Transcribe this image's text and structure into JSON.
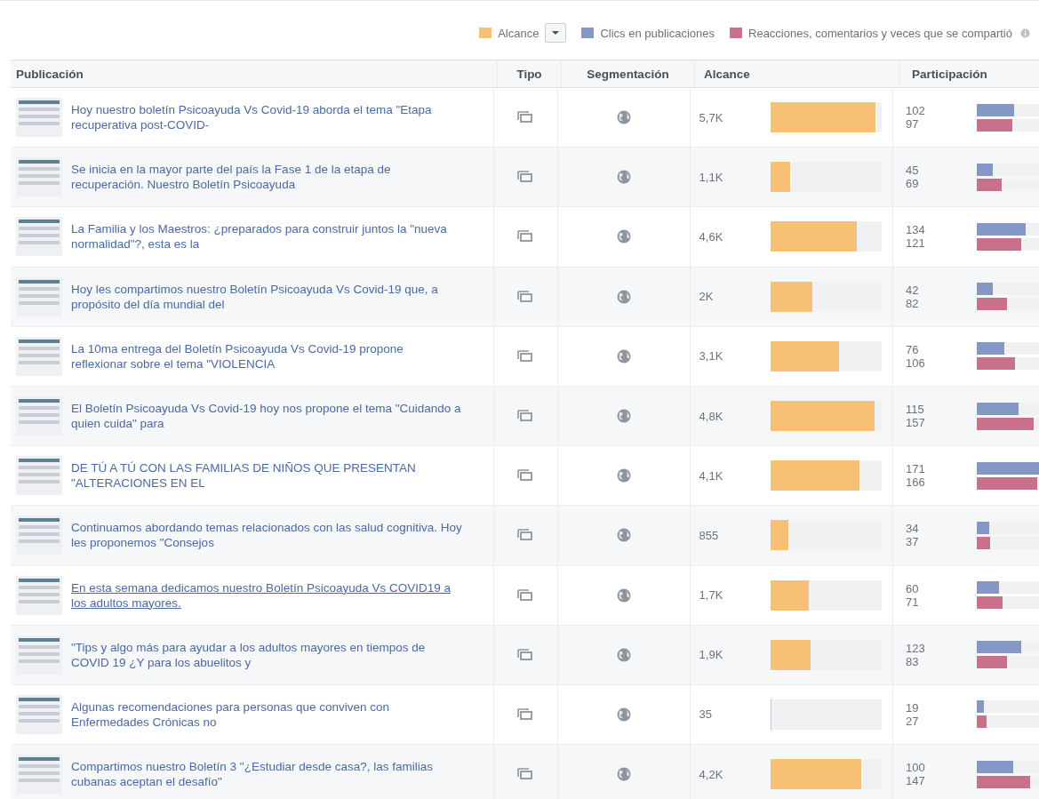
{
  "legend": {
    "items": [
      {
        "label": "Alcance",
        "color": "#f7c074"
      },
      {
        "label": "Clics en publicaciones",
        "color": "#8597c4"
      },
      {
        "label": "Reacciones, comentarios y veces que se compartió",
        "color": "#c9708a"
      }
    ]
  },
  "table": {
    "columns": [
      "Publicación",
      "Tipo",
      "Segmentación",
      "Alcance",
      "Participación"
    ],
    "rows": [
      {
        "text": "Hoy nuestro boletín Psicoayuda Vs Covid-19 aborda el tema \"Etapa recuperativa post-COVID-",
        "hovered": false,
        "reach": {
          "value": "5,7K",
          "level": 0.95
        },
        "clicks": {
          "value": "102",
          "level": 0.6
        },
        "reactions": {
          "value": "97",
          "level": 0.57
        }
      },
      {
        "text": "Se inicia en la mayor parte del país la Fase 1 de la etapa de recuperación. Nuestro Boletín Psicoayuda",
        "hovered": false,
        "reach": {
          "value": "1,1K",
          "level": 0.18
        },
        "clicks": {
          "value": "45",
          "level": 0.26
        },
        "reactions": {
          "value": "69",
          "level": 0.4
        }
      },
      {
        "text": "La Familia y los Maestros: ¿preparados para construir juntos la \"nueva normalidad\"?, esta es la",
        "hovered": false,
        "reach": {
          "value": "4,6K",
          "level": 0.78
        },
        "clicks": {
          "value": "134",
          "level": 0.78
        },
        "reactions": {
          "value": "121",
          "level": 0.71
        }
      },
      {
        "text": "Hoy les compartimos nuestro Boletín Psicoayuda Vs Covid-19 que, a propósito del día mundial del",
        "hovered": false,
        "reach": {
          "value": "2K",
          "level": 0.38
        },
        "clicks": {
          "value": "42",
          "level": 0.25
        },
        "reactions": {
          "value": "82",
          "level": 0.48
        }
      },
      {
        "text": "La 10ma entrega del Boletín Psicoayuda Vs Covid-19 propone reflexionar sobre el tema \"VIOLENCIA",
        "hovered": false,
        "reach": {
          "value": "3,1K",
          "level": 0.62
        },
        "clicks": {
          "value": "76",
          "level": 0.44
        },
        "reactions": {
          "value": "106",
          "level": 0.62
        }
      },
      {
        "text": "El Boletín Psicoayuda Vs Covid-19 hoy nos propone el tema \"Cuidando a quien cuida\" para",
        "hovered": false,
        "reach": {
          "value": "4,8K",
          "level": 0.94
        },
        "clicks": {
          "value": "115",
          "level": 0.67
        },
        "reactions": {
          "value": "157",
          "level": 0.92
        }
      },
      {
        "text": "DE TÚ A TÚ CON LAS FAMILIAS DE NIÑOS QUE PRESENTAN \"ALTERACIONES EN EL",
        "hovered": false,
        "reach": {
          "value": "4,1K",
          "level": 0.8
        },
        "clicks": {
          "value": "171",
          "level": 1
        },
        "reactions": {
          "value": "166",
          "level": 0.97
        }
      },
      {
        "text": "Continuamos abordando temas relacionados con las salud cognitiva. Hoy les proponemos \"Consejos",
        "hovered": false,
        "reach": {
          "value": "855",
          "level": 0.16
        },
        "clicks": {
          "value": "34",
          "level": 0.2
        },
        "reactions": {
          "value": "37",
          "level": 0.22
        }
      },
      {
        "text": "En esta semana dedicamos nuestro Boletín Psicoayuda Vs COVID19 a los adultos mayores.",
        "hovered": true,
        "reach": {
          "value": "1,7K",
          "level": 0.35
        },
        "clicks": {
          "value": "60",
          "level": 0.35
        },
        "reactions": {
          "value": "71",
          "level": 0.42
        }
      },
      {
        "text": "\"Tips y algo más para ayudar a los adultos mayores en tiempos de COVID 19 ¿Y para los abuelitos y",
        "hovered": false,
        "reach": {
          "value": "1,9K",
          "level": 0.36
        },
        "clicks": {
          "value": "123",
          "level": 0.72
        },
        "reactions": {
          "value": "83",
          "level": 0.49
        }
      },
      {
        "text": "Algunas recomendaciones para personas que conviven con Enfermedades Crónicas no",
        "hovered": false,
        "reach": {
          "value": "35",
          "level": 0.01
        },
        "clicks": {
          "value": "19",
          "level": 0.11
        },
        "reactions": {
          "value": "27",
          "level": 0.16
        }
      },
      {
        "text": "Compartimos nuestro Boletín 3 \"¿Estudiar desde casa?, las familias cubanas aceptan el desafío\"",
        "hovered": false,
        "reach": {
          "value": "4,2K",
          "level": 0.82
        },
        "clicks": {
          "value": "100",
          "level": 0.58
        },
        "reactions": {
          "value": "147",
          "level": 0.86
        }
      }
    ]
  }
}
